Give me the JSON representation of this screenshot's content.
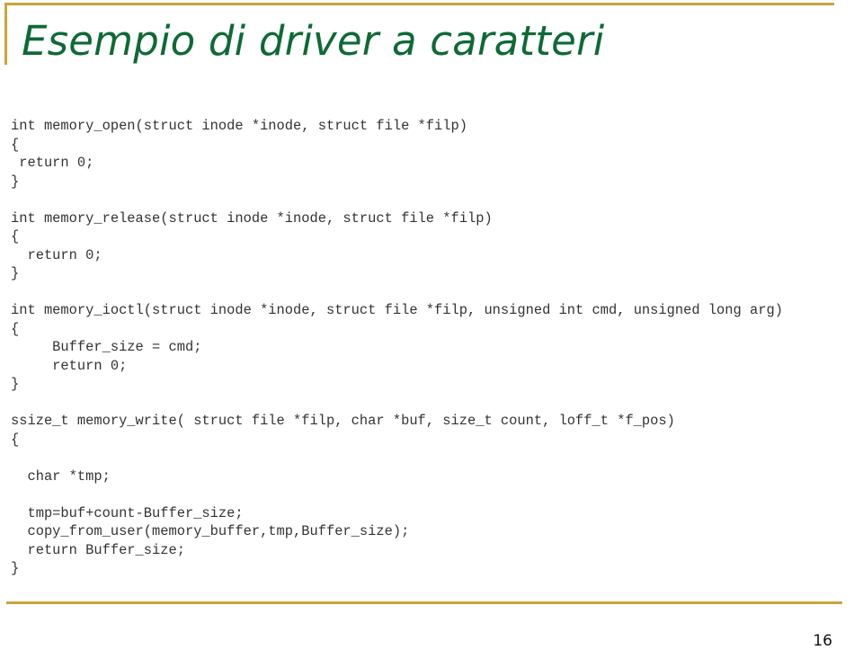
{
  "slide": {
    "title": "Esempio di driver a caratteri",
    "page_number": "16",
    "accent_color": "#c9a63a",
    "title_color": "#0e6a35"
  },
  "code": {
    "lines": [
      "int memory_open(struct inode *inode, struct file *filp)",
      "{",
      " return 0;",
      "}",
      "",
      "int memory_release(struct inode *inode, struct file *filp)",
      "{",
      "  return 0;",
      "}",
      "",
      "int memory_ioctl(struct inode *inode, struct file *filp, unsigned int cmd, unsigned long arg)",
      "{",
      "     Buffer_size = cmd;",
      "     return 0;",
      "}",
      "",
      "ssize_t memory_write( struct file *filp, char *buf, size_t count, loff_t *f_pos)",
      "{",
      "",
      "  char *tmp;",
      "",
      "  tmp=buf+count-Buffer_size;",
      "  copy_from_user(memory_buffer,tmp,Buffer_size);",
      "  return Buffer_size;",
      "}"
    ]
  }
}
